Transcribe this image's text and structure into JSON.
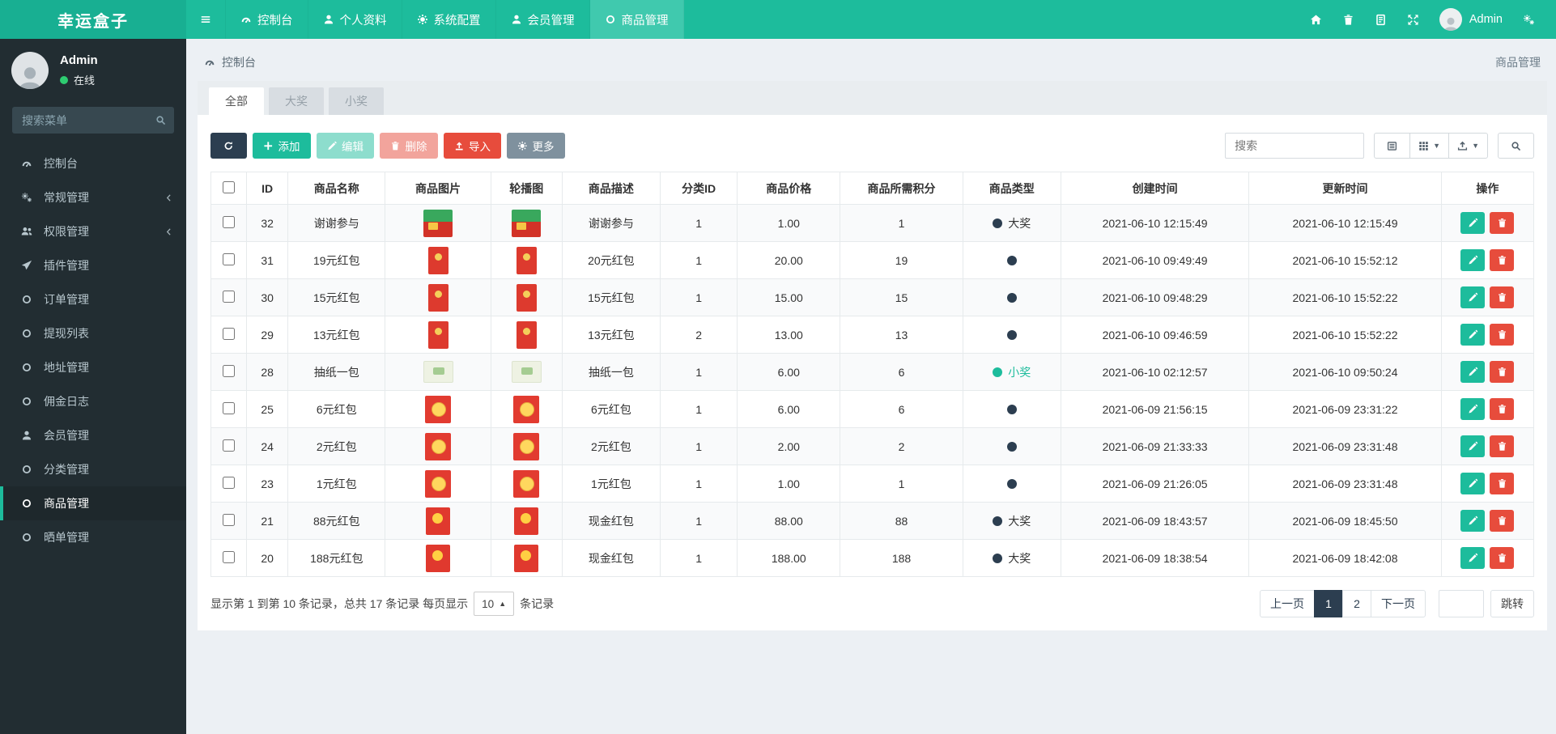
{
  "brand": "幸运盒子",
  "theme": {
    "primary": "#1dbc9c",
    "danger": "#e74c3c",
    "dark_navy": "#2c3e50",
    "sidebar_bg": "#222d32",
    "online_green": "#2ecc71"
  },
  "navbar": {
    "menu": [
      {
        "key": "dashboard",
        "icon": "gauge",
        "label": "控制台"
      },
      {
        "key": "profile",
        "icon": "user",
        "label": "个人资料"
      },
      {
        "key": "config",
        "icon": "gear",
        "label": "系统配置"
      },
      {
        "key": "member",
        "icon": "user",
        "label": "会员管理"
      },
      {
        "key": "product",
        "icon": "circle-o",
        "label": "商品管理",
        "active": true
      }
    ],
    "right_icons": [
      {
        "key": "home",
        "icon": "home"
      },
      {
        "key": "trash",
        "icon": "trash"
      },
      {
        "key": "log",
        "icon": "book"
      },
      {
        "key": "fullscreen",
        "icon": "expand"
      }
    ],
    "user": {
      "name": "Admin"
    }
  },
  "sidebar": {
    "user": {
      "name": "Admin",
      "status": "在线"
    },
    "search_placeholder": "搜索菜单",
    "menu": [
      {
        "key": "dashboard",
        "icon": "gauge",
        "label": "控制台"
      },
      {
        "key": "general",
        "icon": "gears",
        "label": "常规管理",
        "chevron": true
      },
      {
        "key": "auth",
        "icon": "users",
        "label": "权限管理",
        "chevron": true
      },
      {
        "key": "addon",
        "icon": "plane",
        "label": "插件管理"
      },
      {
        "key": "order",
        "icon": "circle-o",
        "label": "订单管理"
      },
      {
        "key": "withdraw",
        "icon": "circle-o",
        "label": "提现列表"
      },
      {
        "key": "address",
        "icon": "circle-o",
        "label": "地址管理"
      },
      {
        "key": "commission",
        "icon": "circle-o",
        "label": "佣金日志"
      },
      {
        "key": "member",
        "icon": "user",
        "label": "会员管理"
      },
      {
        "key": "category",
        "icon": "circle-o",
        "label": "分类管理"
      },
      {
        "key": "product",
        "icon": "circle-o",
        "label": "商品管理",
        "active": true
      },
      {
        "key": "share",
        "icon": "circle-o",
        "label": "晒单管理"
      }
    ]
  },
  "breadcrumb": {
    "left": "控制台",
    "right": "商品管理"
  },
  "tabs": [
    {
      "key": "all",
      "label": "全部",
      "active": true
    },
    {
      "key": "big",
      "label": "大奖"
    },
    {
      "key": "small",
      "label": "小奖"
    }
  ],
  "toolbar": {
    "add": "添加",
    "edit": "编辑",
    "del": "删除",
    "import": "导入",
    "more": "更多",
    "search_placeholder": "搜索"
  },
  "table": {
    "headers": [
      "ID",
      "商品名称",
      "商品图片",
      "轮播图",
      "商品描述",
      "分类ID",
      "商品价格",
      "商品所需积分",
      "商品类型",
      "创建时间",
      "更新时间",
      "操作"
    ],
    "rows": [
      {
        "id": "32",
        "name": "谢谢参与",
        "img": "thanks",
        "desc": "谢谢参与",
        "cat": "1",
        "price": "1.00",
        "points": "1",
        "type_label": "大奖",
        "type_color": "dark",
        "created": "2021-06-10 12:15:49",
        "updated": "2021-06-10 12:15:49"
      },
      {
        "id": "31",
        "name": "19元红包",
        "img": "red-env",
        "desc": "20元红包",
        "cat": "1",
        "price": "20.00",
        "points": "19",
        "type_label": "",
        "type_color": "dark",
        "created": "2021-06-10 09:49:49",
        "updated": "2021-06-10 15:52:12"
      },
      {
        "id": "30",
        "name": "15元红包",
        "img": "red-env",
        "desc": "15元红包",
        "cat": "1",
        "price": "15.00",
        "points": "15",
        "type_label": "",
        "type_color": "dark",
        "created": "2021-06-10 09:48:29",
        "updated": "2021-06-10 15:52:22"
      },
      {
        "id": "29",
        "name": "13元红包",
        "img": "red-env",
        "desc": "13元红包",
        "cat": "2",
        "price": "13.00",
        "points": "13",
        "type_label": "",
        "type_color": "dark",
        "created": "2021-06-10 09:46:59",
        "updated": "2021-06-10 15:52:22"
      },
      {
        "id": "28",
        "name": "抽纸一包",
        "img": "tissue",
        "desc": "抽纸一包",
        "cat": "1",
        "price": "6.00",
        "points": "6",
        "type_label": "小奖",
        "type_color": "green",
        "created": "2021-06-10 02:12:57",
        "updated": "2021-06-10 09:50:24"
      },
      {
        "id": "25",
        "name": "6元红包",
        "img": "red-coin",
        "desc": "6元红包",
        "cat": "1",
        "price": "6.00",
        "points": "6",
        "type_label": "",
        "type_color": "dark",
        "created": "2021-06-09 21:56:15",
        "updated": "2021-06-09 23:31:22"
      },
      {
        "id": "24",
        "name": "2元红包",
        "img": "red-coin",
        "desc": "2元红包",
        "cat": "1",
        "price": "2.00",
        "points": "2",
        "type_label": "",
        "type_color": "dark",
        "created": "2021-06-09 21:33:33",
        "updated": "2021-06-09 23:31:48"
      },
      {
        "id": "23",
        "name": "1元红包",
        "img": "red-coin",
        "desc": "1元红包",
        "cat": "1",
        "price": "1.00",
        "points": "1",
        "type_label": "",
        "type_color": "dark",
        "created": "2021-06-09 21:26:05",
        "updated": "2021-06-09 23:31:48"
      },
      {
        "id": "21",
        "name": "88元红包",
        "img": "red-gold",
        "desc": "现金红包",
        "cat": "1",
        "price": "88.00",
        "points": "88",
        "type_label": "大奖",
        "type_color": "dark",
        "created": "2021-06-09 18:43:57",
        "updated": "2021-06-09 18:45:50"
      },
      {
        "id": "20",
        "name": "188元红包",
        "img": "red-gold",
        "desc": "现金红包",
        "cat": "1",
        "price": "188.00",
        "points": "188",
        "type_label": "大奖",
        "type_color": "dark",
        "created": "2021-06-09 18:38:54",
        "updated": "2021-06-09 18:42:08"
      }
    ]
  },
  "footer": {
    "summary_prefix": "显示第 1 到第 10 条记录，总共 17 条记录 每页显示",
    "per_page": "10",
    "summary_suffix": "条记录",
    "prev": "上一页",
    "pages": [
      "1",
      "2"
    ],
    "active_page": "1",
    "next": "下一页",
    "jump": "跳转"
  }
}
